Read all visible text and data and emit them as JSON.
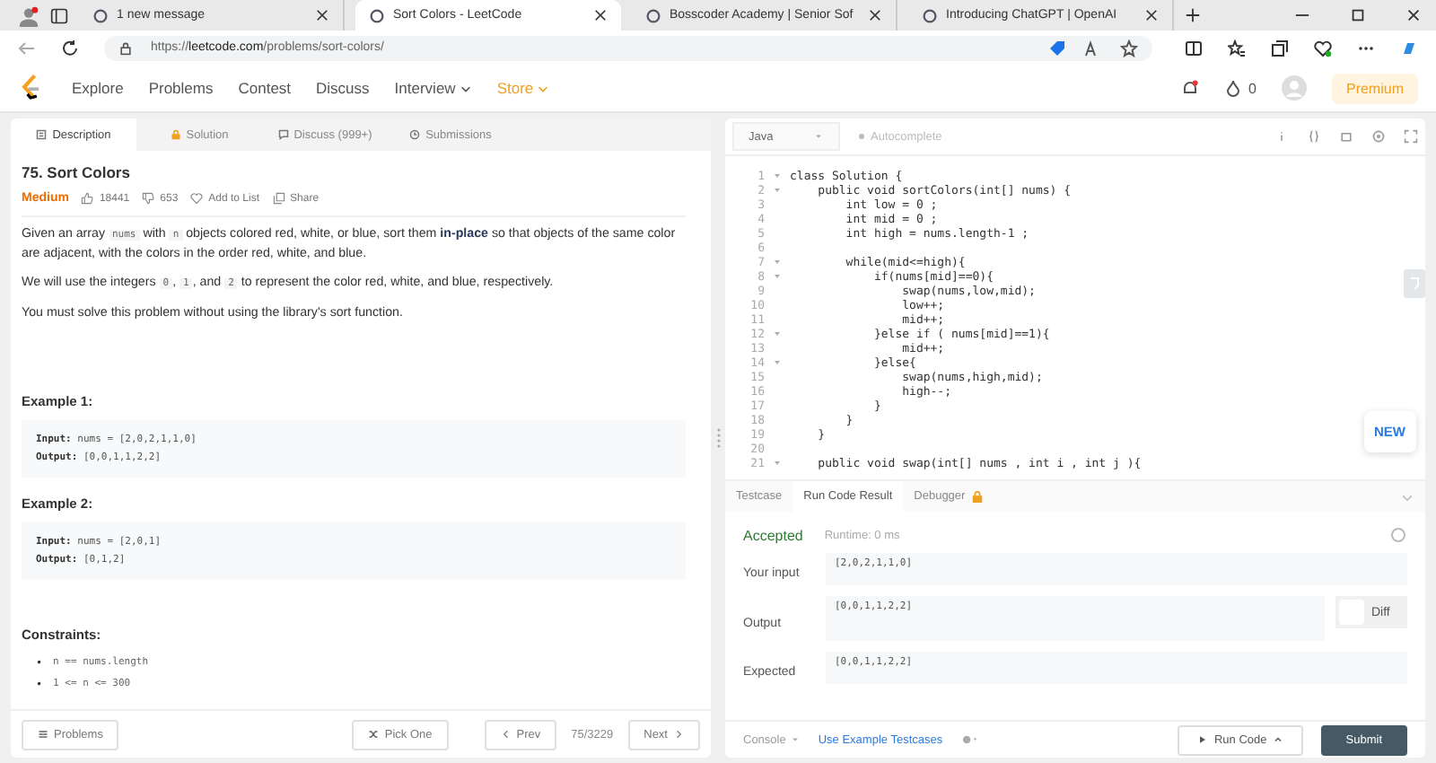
{
  "browser": {
    "tabs": [
      {
        "title": "1 new message",
        "selected": false
      },
      {
        "title": "Sort Colors - LeetCode",
        "selected": true
      },
      {
        "title": "Bosscoder Academy | Senior Sof",
        "selected": false
      },
      {
        "title": "Introducing ChatGPT | OpenAI",
        "selected": false
      }
    ],
    "url": {
      "scheme": "https://",
      "domain": "leetcode.com",
      "path": "/problems/sort-colors/"
    }
  },
  "site_nav": {
    "items": [
      {
        "label": "Explore",
        "dropdown": false,
        "accent": false
      },
      {
        "label": "Problems",
        "dropdown": false,
        "accent": false
      },
      {
        "label": "Contest",
        "dropdown": false,
        "accent": false
      },
      {
        "label": "Discuss",
        "dropdown": false,
        "accent": false
      },
      {
        "label": "Interview",
        "dropdown": true,
        "accent": false
      },
      {
        "label": "Store",
        "dropdown": true,
        "accent": true
      }
    ],
    "streak": "0",
    "premium": "Premium"
  },
  "problem": {
    "tabs": [
      {
        "label": "Description",
        "selected": true
      },
      {
        "label": "Solution",
        "selected": false
      },
      {
        "label": "Discuss (999+)",
        "selected": false
      },
      {
        "label": "Submissions",
        "selected": false
      }
    ],
    "title": "75. Sort Colors",
    "difficulty": "Medium",
    "likes": "18441",
    "dislikes": "653",
    "add_to_list": "Add to List",
    "share": "Share",
    "paragraphs": [
      [
        {
          "kind": "text",
          "text": "Given an array "
        },
        {
          "kind": "code",
          "text": "nums"
        },
        {
          "kind": "text",
          "text": " with "
        },
        {
          "kind": "code",
          "text": "n"
        },
        {
          "kind": "text",
          "text": " objects colored red, white, or blue, sort them "
        },
        {
          "kind": "bold",
          "text": "in-place"
        },
        {
          "kind": "text",
          "text": " so that objects of the same color are adjacent, with the colors in the order red, white, and blue."
        }
      ],
      [
        {
          "kind": "text",
          "text": "We will use the integers "
        },
        {
          "kind": "code",
          "text": "0"
        },
        {
          "kind": "text",
          "text": ", "
        },
        {
          "kind": "code",
          "text": "1"
        },
        {
          "kind": "text",
          "text": ", and "
        },
        {
          "kind": "code",
          "text": "2"
        },
        {
          "kind": "text",
          "text": " to represent the color red, white, and blue, respectively."
        }
      ],
      [
        {
          "kind": "text",
          "text": "You must solve this problem without using the library's sort function."
        }
      ]
    ],
    "examples": [
      {
        "title": "Example 1:",
        "input_label": "Input:",
        "input": "nums = [2,0,2,1,1,0]",
        "output_label": "Output:",
        "output": "[0,0,1,1,2,2]"
      },
      {
        "title": "Example 2:",
        "input_label": "Input:",
        "input": "nums = [2,0,1]",
        "output_label": "Output:",
        "output": "[0,1,2]"
      }
    ],
    "constraints_title": "Constraints:",
    "constraints": [
      {
        "bullet": "•",
        "text": "n == nums.length"
      },
      {
        "bullet": "•",
        "text": "1 <= n <= 300"
      }
    ],
    "footer": {
      "problems": "Problems",
      "pick_one": "Pick One",
      "prev": "Prev",
      "counter": "75/3229",
      "next": "Next"
    }
  },
  "editor": {
    "language": "Java",
    "autocomplete": "Autocomplete",
    "new_badge": "NEW",
    "lines": [
      {
        "num": "1",
        "fold": true,
        "text": "class Solution {"
      },
      {
        "num": "2",
        "fold": true,
        "text": "    public void sortColors(int[] nums) {"
      },
      {
        "num": "3",
        "fold": false,
        "text": "        int low = 0 ;"
      },
      {
        "num": "4",
        "fold": false,
        "text": "        int mid = 0 ;"
      },
      {
        "num": "5",
        "fold": false,
        "text": "        int high = nums.length-1 ;"
      },
      {
        "num": "6",
        "fold": false
      },
      {
        "num": "7",
        "fold": true,
        "text": "        while(mid<=high){"
      },
      {
        "num": "8",
        "fold": true,
        "text": "            if(nums[mid]==0){"
      },
      {
        "num": "9",
        "fold": false,
        "text": "                swap(nums,low,mid);"
      },
      {
        "num": "10",
        "fold": false,
        "text": "                low++;"
      },
      {
        "num": "11",
        "fold": false,
        "text": "                mid++;"
      },
      {
        "num": "12",
        "fold": true,
        "text": "            }else if ( nums[mid]==1){"
      },
      {
        "num": "13",
        "fold": false,
        "text": "                mid++;"
      },
      {
        "num": "14",
        "fold": true,
        "text": "            }else{"
      },
      {
        "num": "15",
        "fold": false,
        "text": "                swap(nums,high,mid);"
      },
      {
        "num": "16",
        "fold": false,
        "text": "                high--;"
      },
      {
        "num": "17",
        "fold": false,
        "text": "            }"
      },
      {
        "num": "18",
        "fold": false,
        "text": "        }"
      },
      {
        "num": "19",
        "fold": false,
        "text": "    }"
      },
      {
        "num": "20",
        "fold": false
      },
      {
        "num": "21",
        "fold": true,
        "text": "    public void swap(int[] nums , int i , int j ){"
      }
    ]
  },
  "result": {
    "tabs": [
      {
        "label": "Testcase",
        "selected": false,
        "locked": false
      },
      {
        "label": "Run Code Result",
        "selected": true,
        "locked": false
      },
      {
        "label": "Debugger",
        "selected": false,
        "locked": true
      }
    ],
    "status": "Accepted",
    "runtime": "Runtime: 0 ms",
    "rows": [
      {
        "label": "Your input",
        "value": "[2,0,2,1,1,0]",
        "diff": false
      },
      {
        "label": "Output",
        "value": "[0,0,1,1,2,2]",
        "diff": true
      },
      {
        "label": "Expected",
        "value": "[0,0,1,1,2,2]",
        "diff": false
      }
    ],
    "diff_label": "Diff",
    "diff_on": false,
    "footer": {
      "console": "Console",
      "example_testcases": "Use Example Testcases",
      "run_code": "Run Code",
      "submit": "Submit"
    }
  }
}
